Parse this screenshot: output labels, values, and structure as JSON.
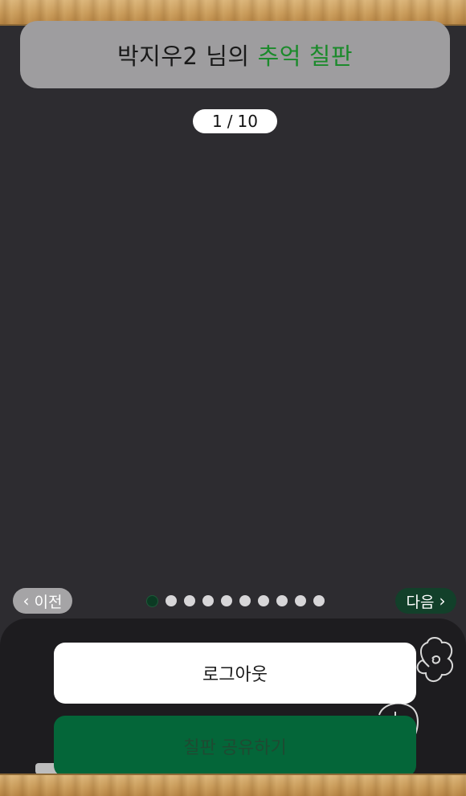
{
  "header": {
    "title_prefix": "박지우2 님의",
    "title_accent": "추억 칠판"
  },
  "pager": {
    "current": "1",
    "separator": "/",
    "total": "10",
    "dot_count": 10,
    "active_dot": 1
  },
  "nav": {
    "prev_label": "이전",
    "next_label": "다음"
  },
  "actions": {
    "logout_label": "로그아웃",
    "share_label": "칠판 공유하기"
  },
  "colors": {
    "board": "#2d2c30",
    "accent_green": "#1b8a2b",
    "share_button": "#046639",
    "next_button": "#12402a"
  }
}
